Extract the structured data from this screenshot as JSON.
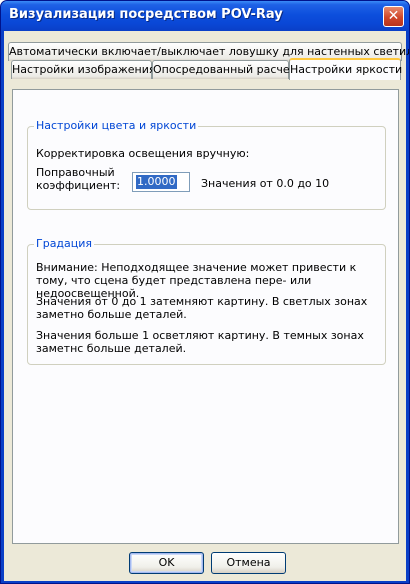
{
  "window": {
    "title": "Визуализация посредством POV-Ray",
    "close_glyph": "✕"
  },
  "tabs_back": [
    {
      "label": "Автоматически включает/выключает ловушку для настенных светильников"
    }
  ],
  "tabs_front": [
    {
      "label": "Настройки изображения"
    },
    {
      "label": "Опосредованный расчет"
    },
    {
      "label": "Настройки яркости"
    }
  ],
  "color_group": {
    "title": "Настройки цвета и яркости",
    "manual_label": "Корректировка освещения вручную:",
    "coef_label_1": "Поправочный",
    "coef_label_2": "коэффициент:",
    "coef_value": "1.0000",
    "range_text": "Значения от 0.0 до 10"
  },
  "gradation_group": {
    "title": "Градация",
    "warning": "Внимание: Неподходящее значение может привести к тому, что сцена будет представлена пере- или недоосвещенной.",
    "below_one": "Значения от 0 до 1 затемняют картину. В светлых зонах заметно больше деталей.",
    "above_one": "Значения больше 1 осветляют картину. В темных зонах заметнс больше деталей."
  },
  "buttons": {
    "ok": "OK",
    "cancel": "Отмена"
  },
  "colors": {
    "titlebar": "#0a47d6",
    "face": "#ece9d8",
    "group_label": "#0046d5",
    "selection": "#316ac5",
    "active_tab_accent": "#ffc83c"
  }
}
